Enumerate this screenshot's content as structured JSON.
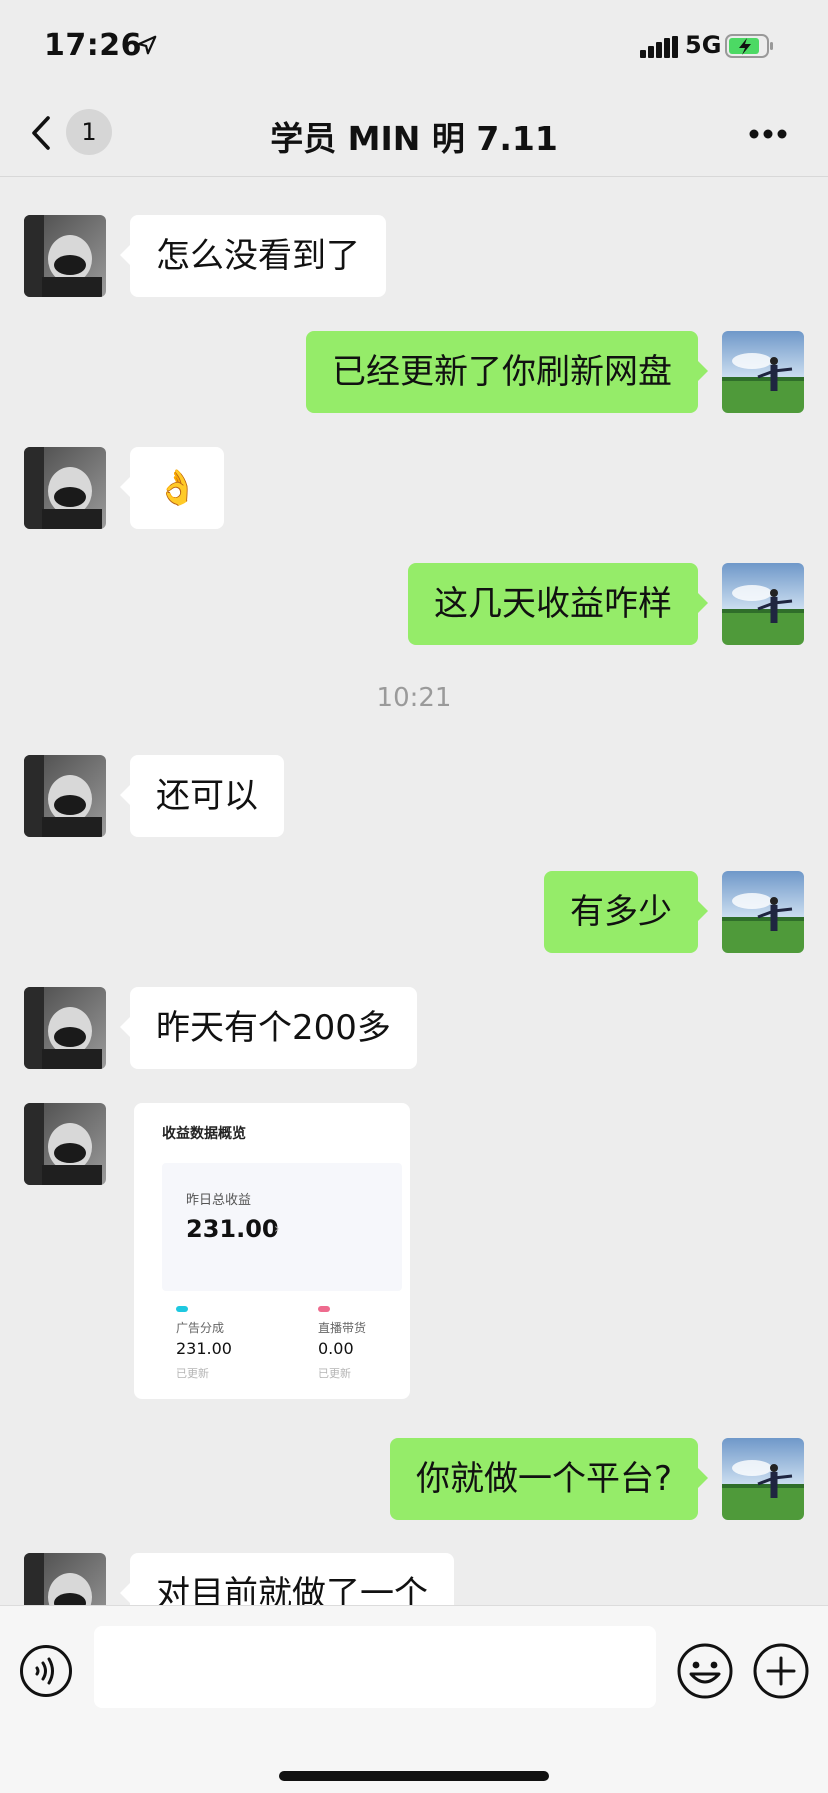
{
  "status_bar": {
    "time": "17:26",
    "network": "5G"
  },
  "nav": {
    "back_label": "1",
    "title": "学员 MIN 明 7.11"
  },
  "messages": [
    {
      "side": "in",
      "text": "怎么没看到了"
    },
    {
      "side": "out",
      "text": "已经更新了你刷新网盘"
    },
    {
      "side": "in",
      "text": "👌"
    },
    {
      "side": "out",
      "text": "这几天收益咋样"
    },
    {
      "side": "time",
      "text": "10:21"
    },
    {
      "side": "in",
      "text": "还可以"
    },
    {
      "side": "out",
      "text": "有多少"
    },
    {
      "side": "in",
      "text": "昨天有个200多"
    },
    {
      "side": "in_image"
    },
    {
      "side": "out",
      "text": "你就做一个平台?"
    },
    {
      "side": "in",
      "text": "对目前就做了一个"
    }
  ],
  "image_card": {
    "title": "收益数据概览",
    "total_label": "昨日总收益",
    "total_value": "231.00",
    "chevron": "›",
    "columns": [
      {
        "label": "广告分成",
        "value": "231.00",
        "note": "已更新",
        "dot_color": "#1ec8e0"
      },
      {
        "label": "直播带货",
        "value": "0.00",
        "note": "已更新",
        "dot_color": "#ee6b8e"
      }
    ]
  },
  "input": {
    "placeholder": ""
  },
  "colors": {
    "outgoing_bubble": "#95ec69",
    "incoming_bubble": "#ffffff",
    "background": "#ededed"
  },
  "icons": [
    "location-arrow-icon",
    "signal-icon",
    "battery-charging-icon",
    "back-chevron-icon",
    "more-dots-icon",
    "voice-icon",
    "emoji-icon",
    "plus-icon"
  ]
}
